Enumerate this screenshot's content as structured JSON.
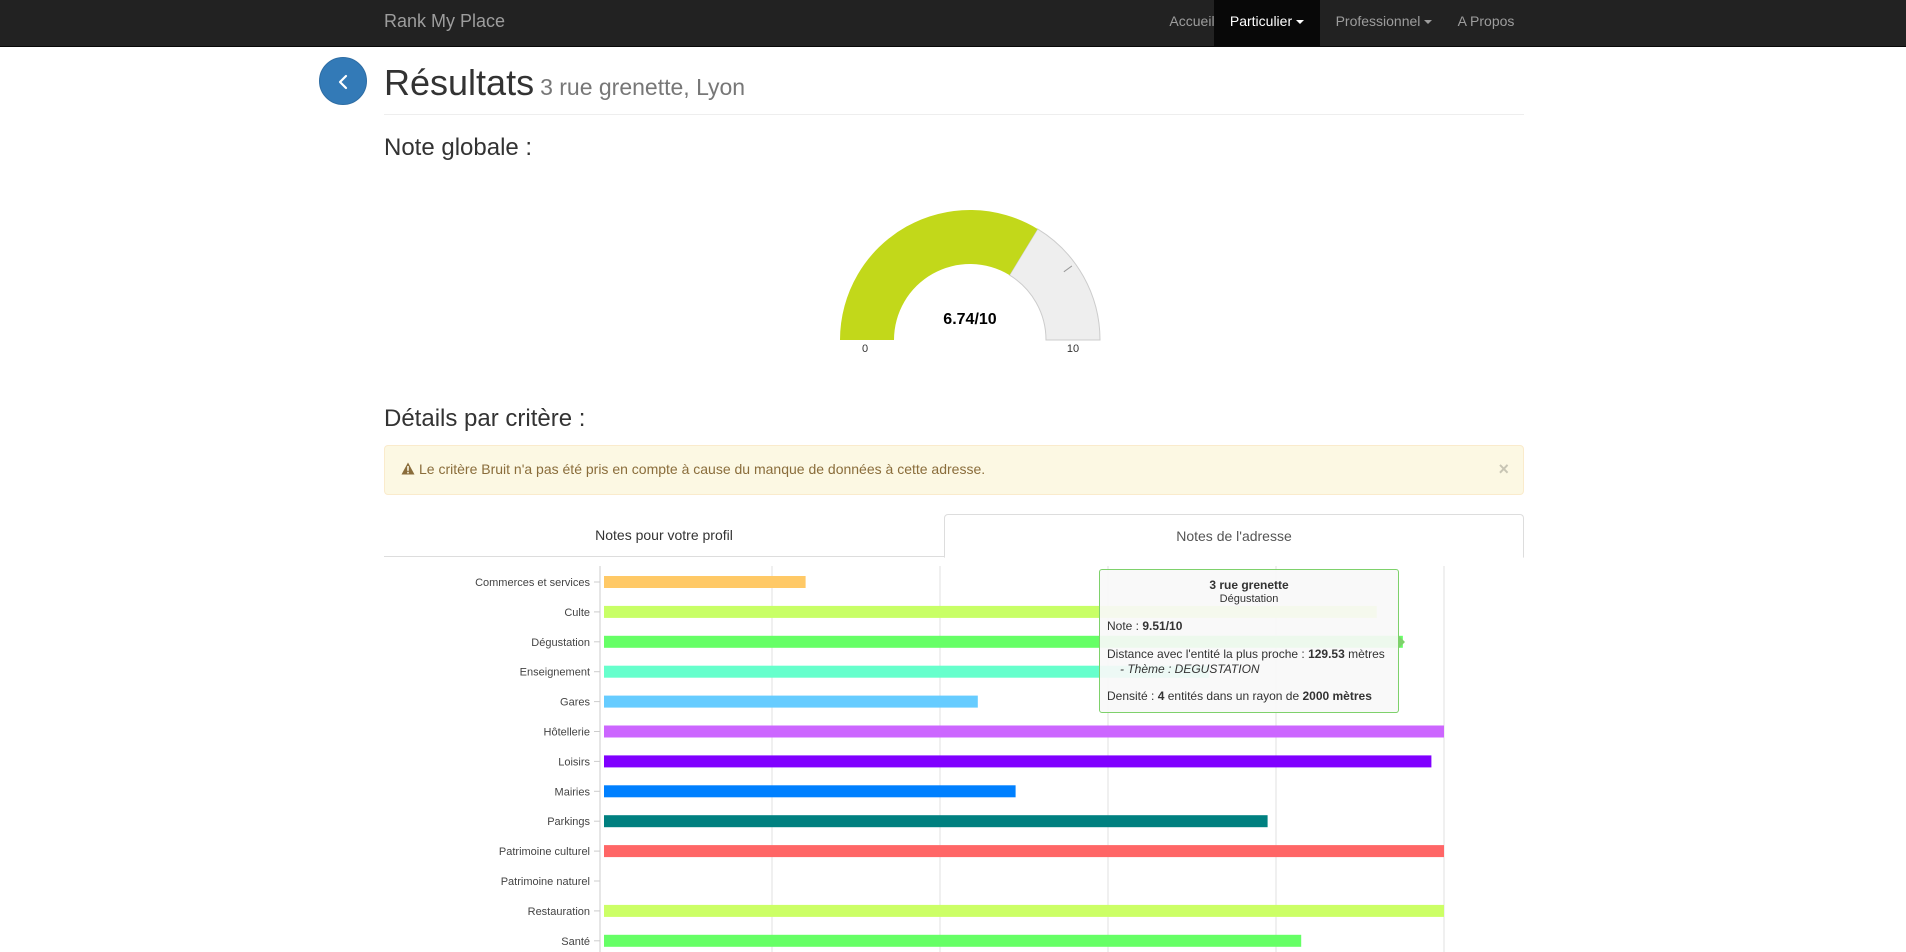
{
  "navbar": {
    "brand": "Rank My Place",
    "items": [
      {
        "label": "Accueil"
      },
      {
        "label": "Particulier"
      },
      {
        "label": "Professionnel"
      },
      {
        "label": "A Propos"
      }
    ]
  },
  "header": {
    "title": "Résultats",
    "subtitle": "3 rue grenette, Lyon"
  },
  "global": {
    "heading": "Note globale :",
    "value_label": "6.74/10",
    "value": 6.74,
    "min": "0",
    "max": "10",
    "fill_color": "#c2d81a",
    "track_color": "#eeeeee"
  },
  "details": {
    "heading": "Détails par critère :"
  },
  "alert": {
    "message": "Le critère Bruit n'a pas été pris en compte à cause du manque de données à cette adresse.",
    "close": "×"
  },
  "tabs": [
    {
      "label": "Notes pour votre profil"
    },
    {
      "label": "Notes de l'adresse"
    }
  ],
  "chart_data": {
    "type": "bar",
    "orientation": "horizontal",
    "xlim": [
      0,
      10
    ],
    "grid": true,
    "categories": [
      "Commerces et services",
      "Culte",
      "Dégustation",
      "Enseignement",
      "Gares",
      "Hôtellerie",
      "Loisirs",
      "Mairies",
      "Parkings",
      "Patrimoine culturel",
      "Patrimoine naturel",
      "Restauration",
      "Santé"
    ],
    "values": [
      2.4,
      9.2,
      9.51,
      7.2,
      4.45,
      10,
      9.85,
      4.9,
      7.9,
      10,
      0,
      10,
      8.3
    ],
    "colors": [
      "#ffc966",
      "#c8ff66",
      "#66ff66",
      "#66ffcc",
      "#66ccff",
      "#cc66ff",
      "#8000ff",
      "#0080ff",
      "#008080",
      "#ff6666",
      "#66ff99",
      "#ccff66",
      "#66ff66"
    ]
  },
  "tooltip": {
    "title": "3 rue grenette",
    "subtitle": "Dégustation",
    "note_label": "Note : ",
    "note_value": "9.51/10",
    "distance_label": "Distance avec l'entité la plus proche : ",
    "distance_value": "129.53",
    "distance_unit": " mètres",
    "theme": "- Thème : DEGUSTATION",
    "density_label": "Densité : ",
    "density_count": "4",
    "density_mid": " entités dans un rayon de ",
    "density_radius": "2000 mètres"
  }
}
